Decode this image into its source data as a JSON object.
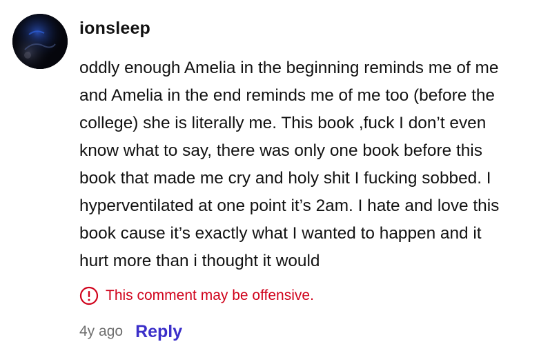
{
  "comment": {
    "username": "ionsleep",
    "body_lines": [
      "oddly enough Amelia in the beginning reminds me of me",
      "and Amelia in the end reminds me of me too (before the",
      "college) she is literally me. This book ,fuck I don’t even",
      "know what to say, there was only one book before this",
      "book that made me cry and holy shit I fucking sobbed. I",
      "hyperventilated at one point it’s 2am. I hate and love this",
      "book cause it’s exactly what I wanted to happen and it",
      "hurt more than i thought it would"
    ],
    "warning_text": "This comment may be offensive.",
    "timestamp": "4y ago",
    "reply_label": "Reply"
  },
  "icons": {
    "warning": "exclamation-circle-icon"
  },
  "colors": {
    "warning": "#d0021b",
    "reply": "#3b2fc9",
    "text": "#121212",
    "muted": "#6f6f6f"
  }
}
